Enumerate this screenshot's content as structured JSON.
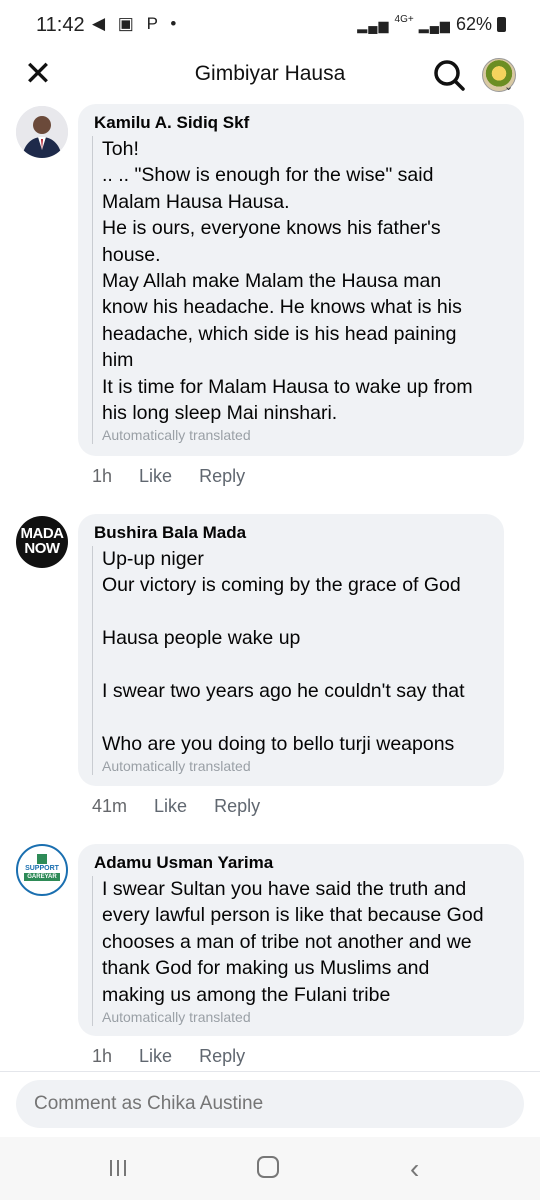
{
  "status": {
    "time": "11:42",
    "left_icons": "◀ ▣ P •",
    "battery": "62%",
    "network": "4G+"
  },
  "header": {
    "title": "Gimbiyar Hausa"
  },
  "comments": [
    {
      "author": "Kamilu A. Sidiq Skf",
      "lines": [
        "Toh!",
        ".. .. \"Show is enough for the wise\" said",
        "Malam Hausa Hausa.",
        "He is ours, everyone knows his father's",
        "house.",
        "May Allah make Malam the Hausa man",
        "know his headache. He knows what is his",
        "headache, which side is his head paining",
        "him",
        "It is time for Malam Hausa to wake up from",
        "his long sleep Mai ninshari."
      ],
      "translated": "Automatically translated",
      "time": "1h",
      "like": "Like",
      "reply": "Reply"
    },
    {
      "author": "Bushira Bala Mada",
      "avatar_text_1": "MADA",
      "avatar_text_2": "NOW",
      "lines": [
        "Up-up niger",
        "Our victory is coming by the grace of God",
        "",
        "Hausa people wake up",
        "",
        "I swear two years ago he couldn't say that",
        "",
        "Who are you doing to bello turji weapons"
      ],
      "translated": "Automatically translated",
      "time": "41m",
      "like": "Like",
      "reply": "Reply"
    },
    {
      "author": "Adamu Usman Yarima",
      "avatar_text_1": "SUPPORT",
      "avatar_text_2": "GAREYAR",
      "lines": [
        "I swear Sultan you have said the truth and",
        "every lawful person is like that because God",
        "chooses a man of tribe not another and we",
        "thank God for making us Muslims and",
        "making us among the Fulani tribe"
      ],
      "translated": "Automatically translated",
      "time": "1h",
      "like": "Like",
      "reply": "Reply"
    }
  ],
  "composer": {
    "placeholder": "Comment as Chika Austine"
  }
}
